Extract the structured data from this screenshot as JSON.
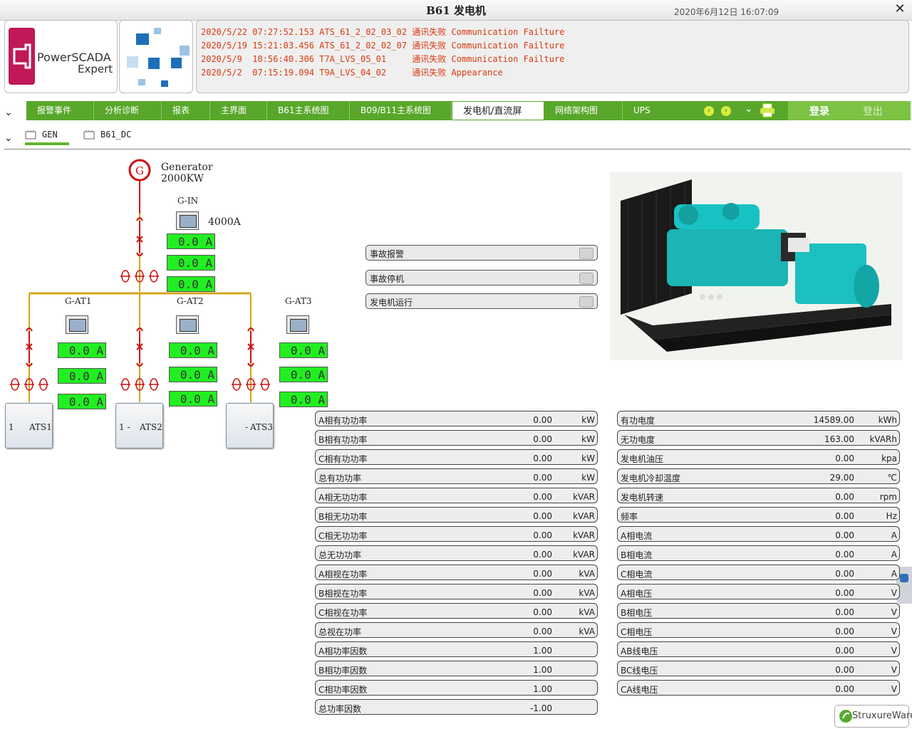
{
  "window": {
    "title": "B61 发电机",
    "datetime": "2020年6月12日  16:07:09",
    "close_label": "✕"
  },
  "logo": {
    "brand_line1": "PowerSCADA",
    "brand_line2": "Expert"
  },
  "alarms": [
    "2020/5/22 07:27:52.153 ATS_61_2_02_03_02 通讯失败 Communication Failture",
    "2020/5/19 15:21:03.456 ATS_61_2_02_02_07 通讯失败 Communication Failture",
    "2020/5/9  10:56:40.306 T7A_LVS_05_01     通讯失败 Communication Failture",
    "2020/5/2  07:15:19.094 T9A_LVS_04_02     通讯失败 Appearance"
  ],
  "nav": {
    "tabs": [
      "报警事件",
      "分析诊断",
      "报表",
      "主界面",
      "B61主系统图",
      "B09/B11主系统图",
      "发电机/直流屏",
      "网络架构图",
      "UPS"
    ],
    "active_index": 6,
    "login": "登录",
    "logout": "登出",
    "prev_icon": "‹",
    "next_icon": "›",
    "dropdown_icon": "⌄",
    "expand_icon": "⌄"
  },
  "subtabs": [
    "GEN",
    "B61_DC"
  ],
  "diagram": {
    "generator_name": "Generator",
    "generator_rating": "2000KW",
    "g_in_label": "G-IN",
    "g_in_rating": "4000A",
    "feeders": [
      "G-AT1",
      "G-AT2",
      "G-AT3"
    ],
    "ats": [
      "ATS1",
      "ATS2",
      "ATS3"
    ],
    "ats_prefix": [
      "1",
      "1 -",
      "-"
    ],
    "g_in_currents": [
      "0.0 A",
      "0.0 A",
      "0.0 A"
    ],
    "at1_currents": [
      "0.0 A",
      "0.0 A",
      "0.0 A"
    ],
    "at2_currents": [
      "0.0 A",
      "0.0 A",
      "0.0 A"
    ],
    "at3_currents": [
      "0.0 A",
      "0.0 A",
      "0.0 A"
    ],
    "line_color": "#d4a419",
    "breaker_color": "#cc1111"
  },
  "status_indicators": [
    "事故报警",
    "事故停机",
    "发电机运行"
  ],
  "left_table": [
    {
      "label": "A相有功功率",
      "value": "0.00",
      "unit": "kW"
    },
    {
      "label": "B相有功功率",
      "value": "0.00",
      "unit": "kW"
    },
    {
      "label": "C相有功功率",
      "value": "0.00",
      "unit": "kW"
    },
    {
      "label": "总有功功率",
      "value": "0.00",
      "unit": "kW"
    },
    {
      "label": "A相无功功率",
      "value": "0.00",
      "unit": "kVAR"
    },
    {
      "label": "B相无功功率",
      "value": "0.00",
      "unit": "kVAR"
    },
    {
      "label": "C相无功功率",
      "value": "0.00",
      "unit": "kVAR"
    },
    {
      "label": "总无功功率",
      "value": "0.00",
      "unit": "kVAR"
    },
    {
      "label": "A相视在功率",
      "value": "0.00",
      "unit": "kVA"
    },
    {
      "label": "B相视在功率",
      "value": "0.00",
      "unit": "kVA"
    },
    {
      "label": "C相视在功率",
      "value": "0.00",
      "unit": "kVA"
    },
    {
      "label": "总视在功率",
      "value": "0.00",
      "unit": "kVA"
    },
    {
      "label": "A相功率因数",
      "value": "1.00",
      "unit": ""
    },
    {
      "label": "B相功率因数",
      "value": "1.00",
      "unit": ""
    },
    {
      "label": "C相功率因数",
      "value": "1.00",
      "unit": ""
    },
    {
      "label": "总功率因数",
      "value": "-1.00",
      "unit": ""
    }
  ],
  "right_table": [
    {
      "label": "有功电度",
      "value": "14589.00",
      "unit": "kWh"
    },
    {
      "label": "无功电度",
      "value": "163.00",
      "unit": "kVARh"
    },
    {
      "label": "发电机油压",
      "value": "0.00",
      "unit": "kpa"
    },
    {
      "label": "发电机冷却温度",
      "value": "29.00",
      "unit": "℃"
    },
    {
      "label": "发电机转速",
      "value": "0.00",
      "unit": "rpm"
    },
    {
      "label": "频率",
      "value": "0.00",
      "unit": "Hz"
    },
    {
      "label": "A相电流",
      "value": "0.00",
      "unit": "A"
    },
    {
      "label": "B相电流",
      "value": "0.00",
      "unit": "A"
    },
    {
      "label": "C相电流",
      "value": "0.00",
      "unit": "A"
    },
    {
      "label": "A相电压",
      "value": "0.00",
      "unit": "V"
    },
    {
      "label": "B相电压",
      "value": "0.00",
      "unit": "V"
    },
    {
      "label": "C相电压",
      "value": "0.00",
      "unit": "V"
    },
    {
      "label": "AB线电压",
      "value": "0.00",
      "unit": "V"
    },
    {
      "label": "BC线电压",
      "value": "0.00",
      "unit": "V"
    },
    {
      "label": "CA线电压",
      "value": "0.00",
      "unit": "V"
    }
  ],
  "footer_brand": "StruxureWare"
}
